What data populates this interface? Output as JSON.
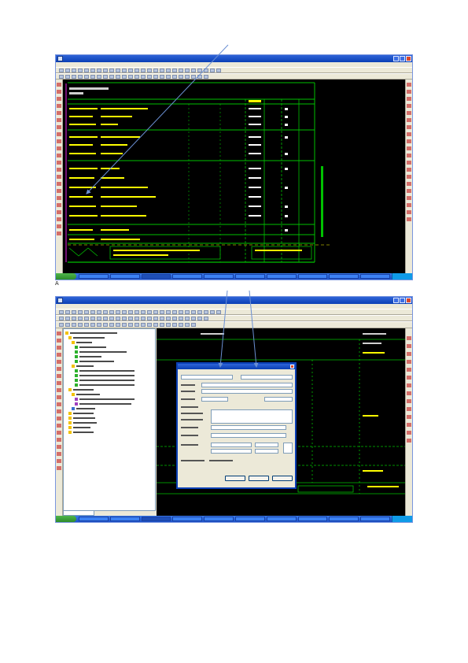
{
  "page_marker": "A",
  "screenshot_top": {
    "title": "",
    "taskbar": {
      "start_label": "",
      "clock": ""
    }
  },
  "screenshot_bottom": {
    "title": "",
    "dialog": {
      "title": ""
    },
    "tree_tab_label": "",
    "taskbar": {
      "start_label": "",
      "clock": ""
    }
  },
  "colors": {
    "xp_blue": "#0a3fb5",
    "cad_green": "#00ff00",
    "cad_yellow": "#ffff00",
    "canvas_bg": "#000000",
    "annotation_arrow": "#6a8fd3"
  },
  "icons": [
    "arrow-annotation",
    "window-close-icon",
    "start-button-icon"
  ]
}
